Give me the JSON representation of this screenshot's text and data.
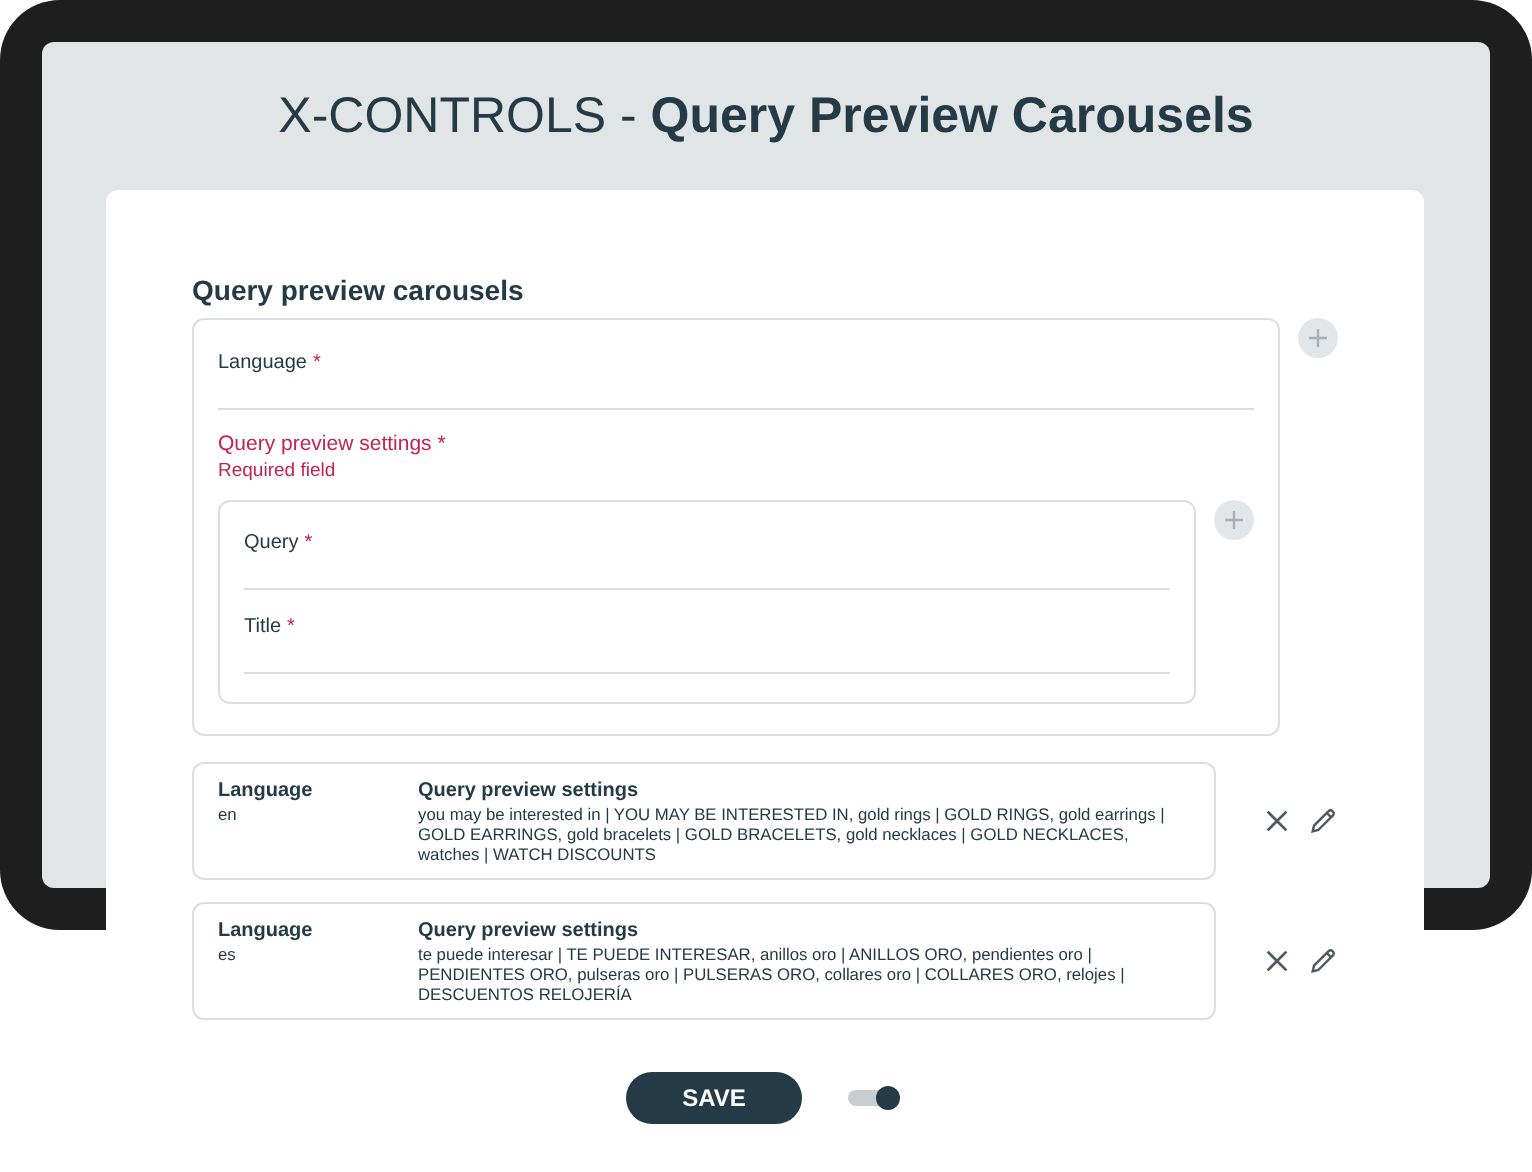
{
  "title": "X-CONTROLS - **Query Preview Carousels**",
  "form": {
    "heading": "Query preview carousels",
    "fields": [
      {
        "label": "Language",
        "mark": "*"
      }
    ],
    "group": {
      "label": "Query preview settings",
      "mark": "*",
      "invalid": true,
      "error": "Required field",
      "fields": [
        {
          "label": "Query",
          "mark": "*"
        },
        {
          "label": "Title",
          "mark": "*"
        }
      ]
    }
  },
  "entries": [
    {
      "columns": [
        {
          "label": "Language",
          "value": "en"
        },
        {
          "label": "Query preview settings",
          "value": "you may be interested in | YOU MAY BE INTERESTED IN, gold rings | GOLD RINGS, gold earrings | GOLD EARRINGS, gold bracelets | GOLD BRACELETS, gold necklaces | GOLD NECKLACES, watches | WATCH DISCOUNTS"
        }
      ]
    },
    {
      "columns": [
        {
          "label": "Language",
          "value": "es"
        },
        {
          "label": "Query preview settings",
          "value": "te puede interesar | TE PUEDE INTERESAR, anillos oro | ANILLOS ORO, pendientes oro | PENDIENTES ORO, pulseras oro | PULSERAS ORO, collares oro | COLLARES ORO, relojes | DESCUENTOS RELOJERÍA"
        }
      ]
    }
  ],
  "save": "SAVE",
  "toggle": {
    "on": true
  }
}
